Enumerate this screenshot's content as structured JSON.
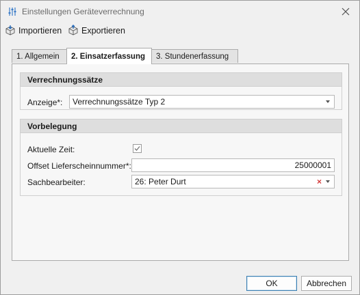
{
  "window": {
    "title": "Einstellungen Geräteverrechnung"
  },
  "toolbar": {
    "import_label": "Importieren",
    "export_label": "Exportieren"
  },
  "tabs": [
    {
      "label": "1. Allgemein"
    },
    {
      "label": "2. Einsatzerfassung"
    },
    {
      "label": "3. Stundenerfassung"
    }
  ],
  "active_tab_index": 1,
  "verrechnung": {
    "header": "Verrechnungssätze",
    "anzeige_label": "Anzeige*:",
    "anzeige_value": "Verrechnungssätze Typ 2"
  },
  "vorbelegung": {
    "header": "Vorbelegung",
    "aktuelle_zeit_label": "Aktuelle Zeit:",
    "aktuelle_zeit_checked": true,
    "offset_label": "Offset Lieferscheinnummer*:",
    "offset_value": "25000001",
    "sachbearbeiter_label": "Sachbearbeiter:",
    "sachbearbeiter_value": "26: Peter Durt"
  },
  "buttons": {
    "ok_label": "OK",
    "cancel_label": "Abbrechen"
  }
}
